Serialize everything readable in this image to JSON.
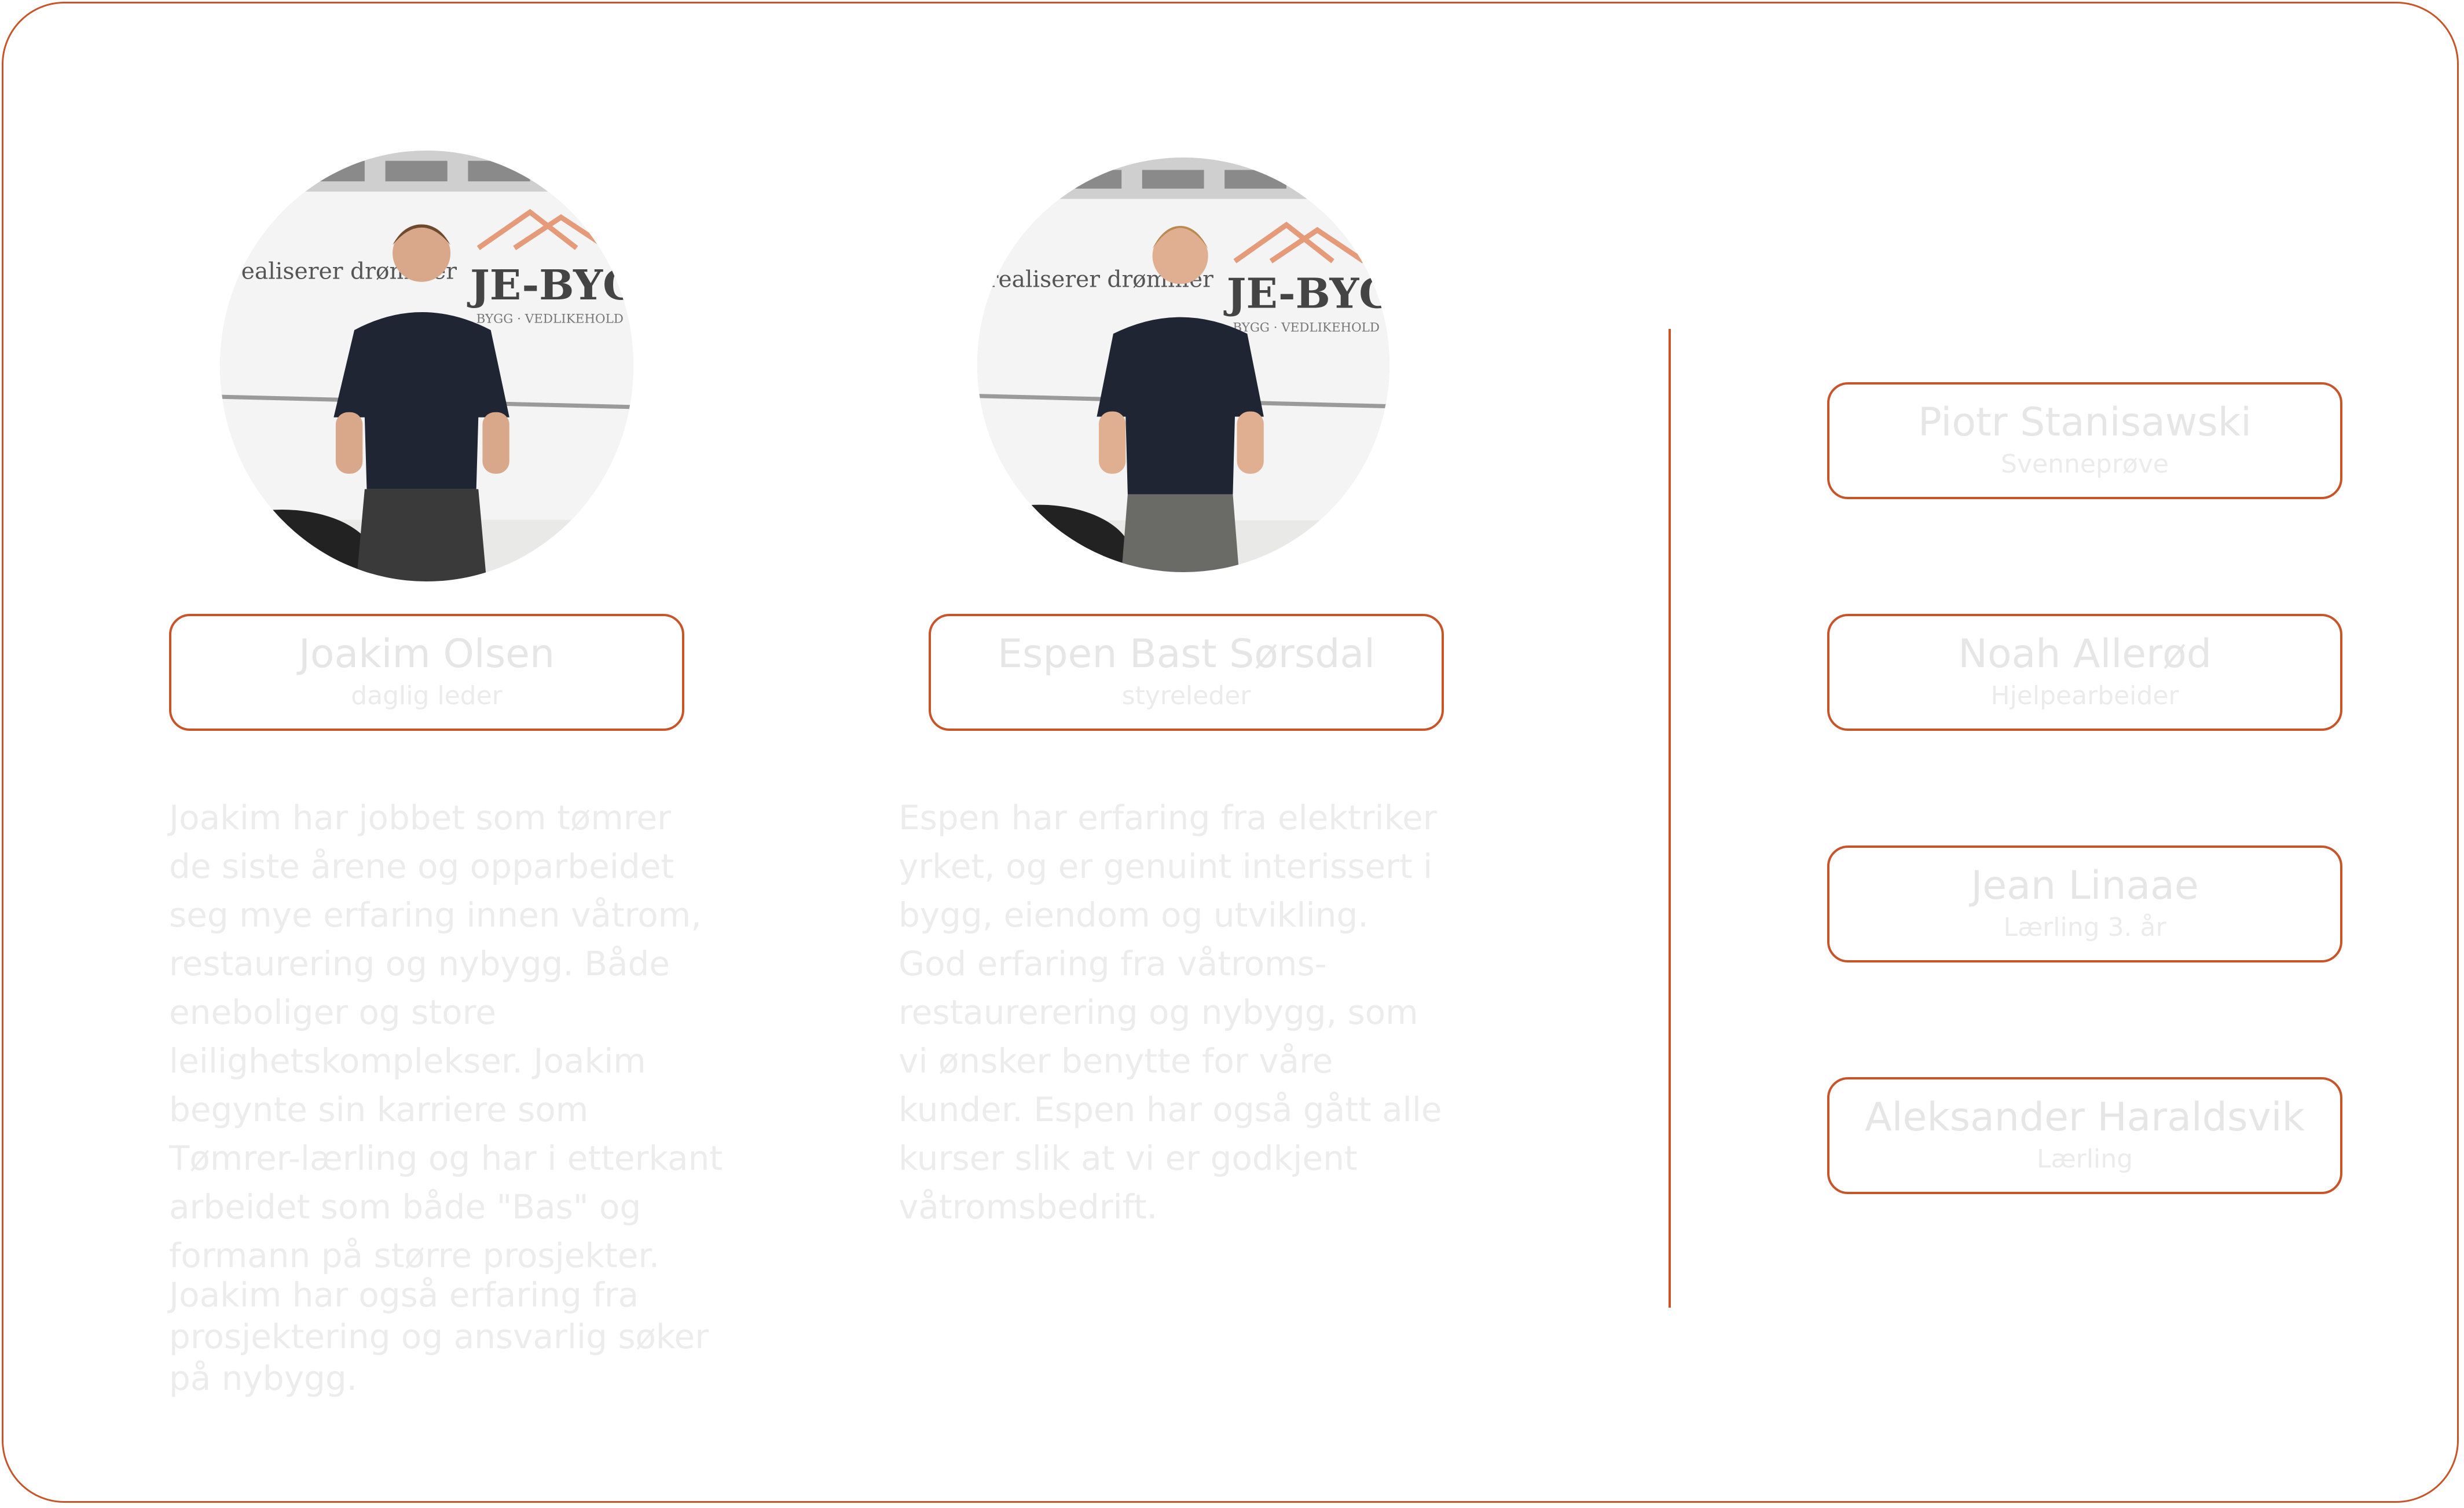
{
  "colors": {
    "accent": "#c8552a",
    "faded_text": "#e6e6e6"
  },
  "photo_text": {
    "van_slogan": "realiserer drømmer",
    "company": "JE-BYGG",
    "company_sub": "BYGG · VEDLIKEHOLD"
  },
  "team_main": [
    {
      "name": "Joakim Olsen",
      "role": "daglig leder",
      "bio": "Joakim har jobbet som tømrer\nde siste årene og opparbeidet\nseg mye erfaring innen våtrom,\nrestaurering og nybygg. Både\neneboliger og store\nleilighetskomplekser. Joakim\nbegynte sin karriere som\nTømrer-lærling og har i etterkant\narbeidet som både \"Bas\" og\nformann på større prosjekter.",
      "bio_extra": "Joakim har også erfaring fra\nprosjektering og ansvarlig søker\npå nybygg."
    },
    {
      "name": "Espen Bast Sørsdal",
      "role": "styreleder",
      "bio": "Espen har erfaring fra elektriker\nyrket, og er genuint interissert i\nbygg, eiendom og utvikling.\nGod erfaring fra våtroms-\nrestaurerering og nybygg, som\nvi ønsker benytte for våre\nkunder. Espen har også gått alle\nkurser slik at vi er godkjent\nvåtromsbedrift."
    }
  ],
  "team_other": [
    {
      "name": "Piotr Stanisawski",
      "role": "Svenneprøve"
    },
    {
      "name": "Noah Allerød",
      "role": "Hjelpearbeider"
    },
    {
      "name": "Jean Linaae",
      "role": "Lærling 3. år"
    },
    {
      "name": "Aleksander Haraldsvik",
      "role": "Lærling"
    }
  ]
}
